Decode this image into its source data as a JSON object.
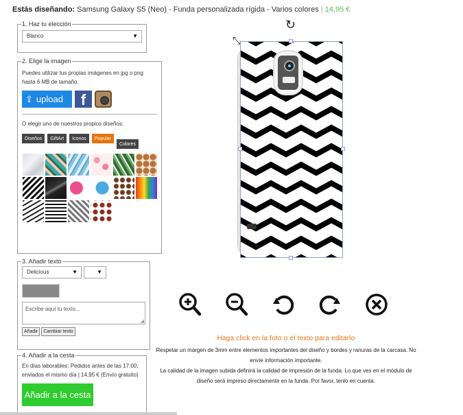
{
  "header": {
    "label": "Estás diseñando:",
    "product": "Samsung Galaxy S5 (Neo) - Funda personalizada rígida - Varios colores",
    "separator": "|",
    "price": "14,95 €"
  },
  "step1": {
    "legend": "1. Haz tu elección",
    "selected_color": "Blanco"
  },
  "step2": {
    "legend": "2. Elige la imagen",
    "instructions": "Puedes utilizar tus propias imágenes en jpg o png hasta 6 MB de tamaño.",
    "upload_label": "upload",
    "facebook_letter": "f",
    "designs_intro": "O elegir uno de nuestros propios diseños:",
    "categories": [
      "Diseños",
      "GiftArt",
      "Iconos",
      "Popular",
      "Colores"
    ],
    "active_category": "Popular",
    "thumbnails": [
      "marble",
      "pineapple",
      "blue-marble",
      "flamingo",
      "palm-leaves",
      "gingerbread",
      "chevron",
      "black-marble",
      "pink-heart",
      "blue-heart",
      "coffee-beans",
      "rainbow-paint",
      "zigzag",
      "stripes",
      "grey-chevron",
      "lips"
    ]
  },
  "step3": {
    "legend": "3. Añadir texto",
    "font": "Delicious",
    "size": "",
    "text_placeholder": "Escribe aquí tu texto...",
    "add_label": "Añadir",
    "change_label": "Cambiar texto",
    "text_color": "#888888"
  },
  "step4": {
    "legend": "4. Añadir a la cesta",
    "delivery_text": "En días laborables: Pedidos antes de las 17:00, enviados el mismo día | 14,95 € (Envío gratuito)",
    "cart_button": "Añadir a la cesta"
  },
  "editor": {
    "tools": [
      "zoom-in-icon",
      "zoom-out-icon",
      "rotate-left-icon",
      "rotate-right-icon",
      "delete-icon"
    ],
    "click_hint": "Haga click en la foto o el texto para editarlo",
    "info_line1": "Respetar un margen de 3mm entre elementos importantes del diseño y bordes y ranuras de la carcasa. No envíe información importante.",
    "info_line2": "La calidad de la imagen subida definirá la calidad de impresión de la funda. Lo que ves en el módulo de diseño será impreso directamente en la funda. Por favor, tenlo en cuenta."
  },
  "colors": {
    "accent_orange": "#e8720f",
    "price_green": "#5cb85c",
    "cart_green": "#2ecc2e",
    "upload_blue": "#1e88e5"
  }
}
